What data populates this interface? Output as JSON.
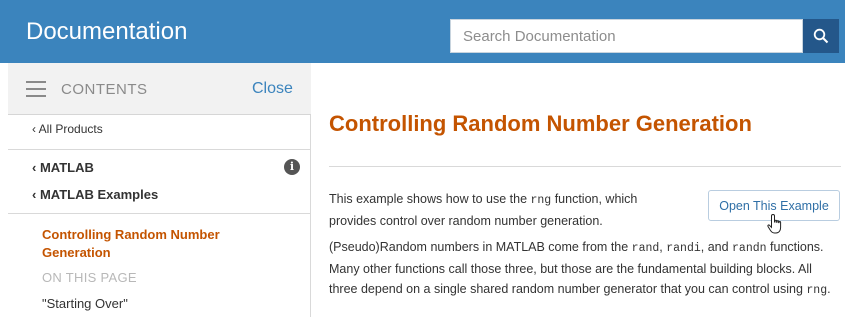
{
  "header": {
    "title": "Documentation",
    "search_placeholder": "Search Documentation"
  },
  "sidebar": {
    "contents_label": "CONTENTS",
    "close_label": "Close",
    "all_products": "All Products",
    "matlab": "MATLAB",
    "matlab_examples": "MATLAB Examples",
    "current_page": "Controlling Random Number Generation",
    "on_this_page": "ON THIS PAGE",
    "items": [
      {
        "label": "\"Starting Over\""
      }
    ]
  },
  "main": {
    "title": "Controlling Random Number Generation",
    "open_example_label": "Open This Example",
    "intro": {
      "before": "This example shows how to use the ",
      "code": "rng",
      "after": " function, which provides control over random number generation."
    },
    "para2": {
      "t1": "(Pseudo)Random numbers in MATLAB come from the ",
      "c1": "rand",
      "t2": ", ",
      "c2": "randi",
      "t3": ", and ",
      "c3": "randn",
      "t4": " functions. Many other functions call those three, but those are the fundamental building blocks. All three depend on a single shared random number generator that you can control using ",
      "c4": "rng",
      "t5": "."
    }
  },
  "icons": {
    "search": "search-icon",
    "menu": "hamburger-menu-icon",
    "info": "info-icon",
    "cursor": "hand-pointer-icon"
  },
  "colors": {
    "header_bg": "#3b84bd",
    "search_button_bg": "#24578a",
    "accent_orange": "#c45400",
    "link_blue": "#3b84bd"
  }
}
